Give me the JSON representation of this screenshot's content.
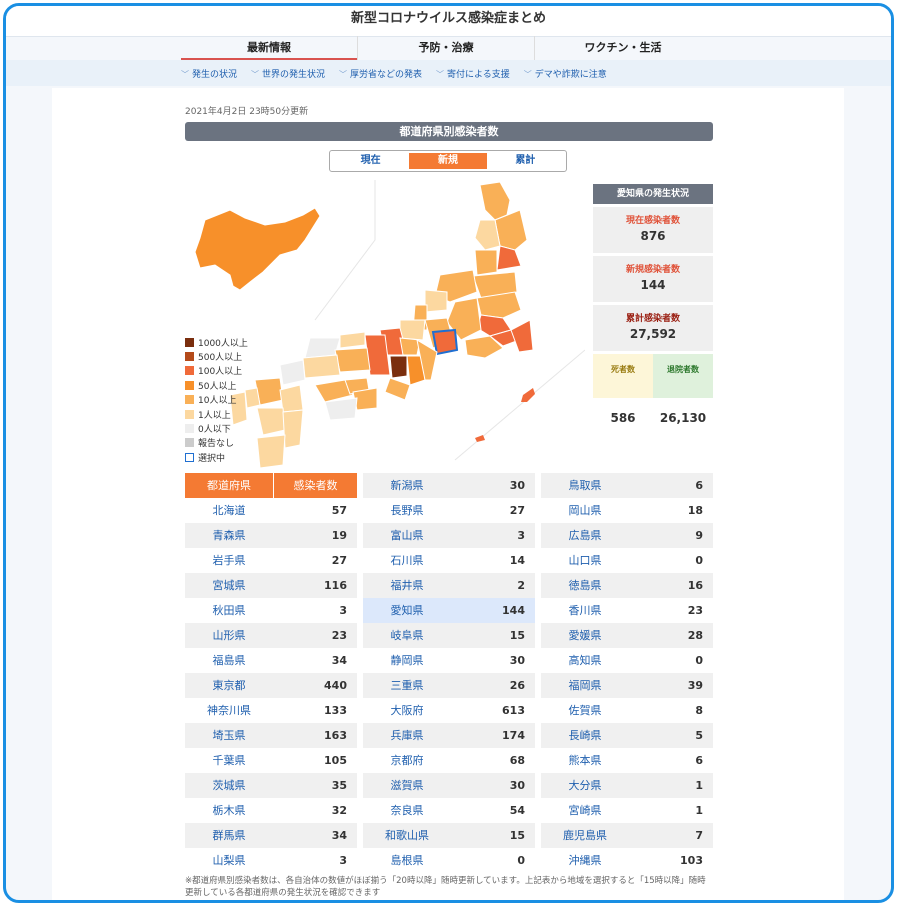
{
  "title": "新型コロナウイルス感染症まとめ",
  "nav_tabs": [
    "最新情報",
    "予防・治療",
    "ワクチン・生活"
  ],
  "sub_nav": [
    "発生の状況",
    "世界の発生状況",
    "厚労省などの発表",
    "寄付による支援",
    "デマや詐欺に注意"
  ],
  "updated": "2021年4月2日 23時50分更新",
  "section_title": "都道府県別感染者数",
  "segments": [
    "現在",
    "新規",
    "累計"
  ],
  "active_segment": "新規",
  "legend": [
    {
      "label": "1000人以上",
      "color": "#7a2e0e"
    },
    {
      "label": "500人以上",
      "color": "#b44a1a"
    },
    {
      "label": "100人以上",
      "color": "#f06a3a"
    },
    {
      "label": "50人以上",
      "color": "#f7902a"
    },
    {
      "label": "10人以上",
      "color": "#f9b057"
    },
    {
      "label": "1人以上",
      "color": "#fcd8a0"
    },
    {
      "label": "0人以下",
      "color": "#eeeeee"
    },
    {
      "label": "報告なし",
      "color": "#cccccc"
    },
    {
      "label": "選択中",
      "color": "#ffffff"
    }
  ],
  "panel": {
    "header": "愛知県の発生状況",
    "current_label": "現在感染者数",
    "current_value": "876",
    "new_label": "新規感染者数",
    "new_value": "144",
    "total_label": "累計感染者数",
    "total_value": "27,592",
    "deaths_label": "死者数",
    "deaths_value": "586",
    "recovered_label": "退院者数",
    "recovered_value": "26,130"
  },
  "table_header": [
    "都道府県",
    "感染者数"
  ],
  "columns": [
    [
      [
        "北海道",
        "57"
      ],
      [
        "青森県",
        "19"
      ],
      [
        "岩手県",
        "27"
      ],
      [
        "宮城県",
        "116"
      ],
      [
        "秋田県",
        "3"
      ],
      [
        "山形県",
        "23"
      ],
      [
        "福島県",
        "34"
      ],
      [
        "東京都",
        "440"
      ],
      [
        "神奈川県",
        "133"
      ],
      [
        "埼玉県",
        "163"
      ],
      [
        "千葉県",
        "105"
      ],
      [
        "茨城県",
        "35"
      ],
      [
        "栃木県",
        "32"
      ],
      [
        "群馬県",
        "34"
      ],
      [
        "山梨県",
        "3"
      ]
    ],
    [
      [
        "新潟県",
        "30"
      ],
      [
        "長野県",
        "27"
      ],
      [
        "富山県",
        "3"
      ],
      [
        "石川県",
        "14"
      ],
      [
        "福井県",
        "2"
      ],
      [
        "愛知県",
        "144"
      ],
      [
        "岐阜県",
        "15"
      ],
      [
        "静岡県",
        "30"
      ],
      [
        "三重県",
        "26"
      ],
      [
        "大阪府",
        "613"
      ],
      [
        "兵庫県",
        "174"
      ],
      [
        "京都府",
        "68"
      ],
      [
        "滋賀県",
        "30"
      ],
      [
        "奈良県",
        "54"
      ],
      [
        "和歌山県",
        "15"
      ],
      [
        "島根県",
        "0"
      ]
    ],
    [
      [
        "鳥取県",
        "6"
      ],
      [
        "岡山県",
        "18"
      ],
      [
        "広島県",
        "9"
      ],
      [
        "山口県",
        "0"
      ],
      [
        "徳島県",
        "16"
      ],
      [
        "香川県",
        "23"
      ],
      [
        "愛媛県",
        "28"
      ],
      [
        "高知県",
        "0"
      ],
      [
        "福岡県",
        "39"
      ],
      [
        "佐賀県",
        "8"
      ],
      [
        "長崎県",
        "5"
      ],
      [
        "熊本県",
        "6"
      ],
      [
        "大分県",
        "1"
      ],
      [
        "宮崎県",
        "1"
      ],
      [
        "鹿児島県",
        "7"
      ],
      [
        "沖縄県",
        "103"
      ]
    ]
  ],
  "selected": "愛知県",
  "footnote": "※都道府県別感染者数は、各自治体の数値がほぼ揃う「20時以降」随時更新しています。上記表から地域を選択すると「15時以降」随時更新している各都道府県の発生状況を確認できます"
}
